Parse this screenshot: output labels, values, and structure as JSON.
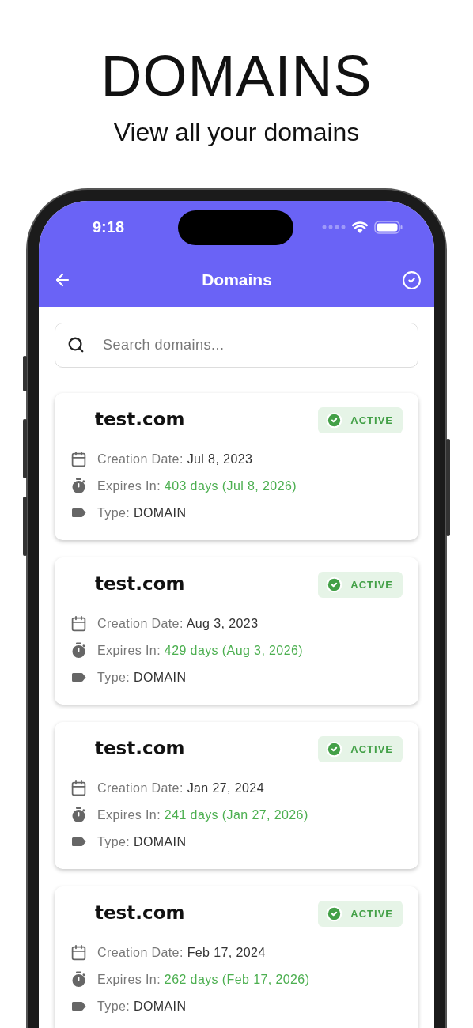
{
  "header": {
    "title": "DOMAINS",
    "subtitle": "View all your domains"
  },
  "status_bar": {
    "time": "9:18"
  },
  "app_bar": {
    "title": "Domains"
  },
  "search": {
    "placeholder": "Search domains..."
  },
  "domains": [
    {
      "name": "test.com",
      "status": "ACTIVE",
      "details": [
        {
          "kind": "created",
          "label": "Creation Date:",
          "value": "Jul 8, 2023"
        },
        {
          "kind": "expires",
          "label": "Expires In:",
          "value": "403 days (Jul 8, 2026)"
        },
        {
          "kind": "type",
          "label": "Type:",
          "value": "DOMAIN"
        }
      ]
    },
    {
      "name": "test.com",
      "status": "ACTIVE",
      "details": [
        {
          "kind": "created",
          "label": "Creation Date:",
          "value": "Aug 3, 2023"
        },
        {
          "kind": "expires",
          "label": "Expires In:",
          "value": "429 days (Aug 3, 2026)"
        },
        {
          "kind": "type",
          "label": "Type:",
          "value": "DOMAIN"
        }
      ]
    },
    {
      "name": "test.com",
      "status": "ACTIVE",
      "details": [
        {
          "kind": "created",
          "label": "Creation Date:",
          "value": "Jan 27, 2024"
        },
        {
          "kind": "expires",
          "label": "Expires In:",
          "value": "241 days (Jan 27, 2026)"
        },
        {
          "kind": "type",
          "label": "Type:",
          "value": "DOMAIN"
        }
      ]
    },
    {
      "name": "test.com",
      "status": "ACTIVE",
      "details": [
        {
          "kind": "created",
          "label": "Creation Date:",
          "value": "Feb 17, 2024"
        },
        {
          "kind": "expires",
          "label": "Expires In:",
          "value": "262 days (Feb 17, 2026)"
        },
        {
          "kind": "type",
          "label": "Type:",
          "value": "DOMAIN"
        }
      ]
    }
  ]
}
